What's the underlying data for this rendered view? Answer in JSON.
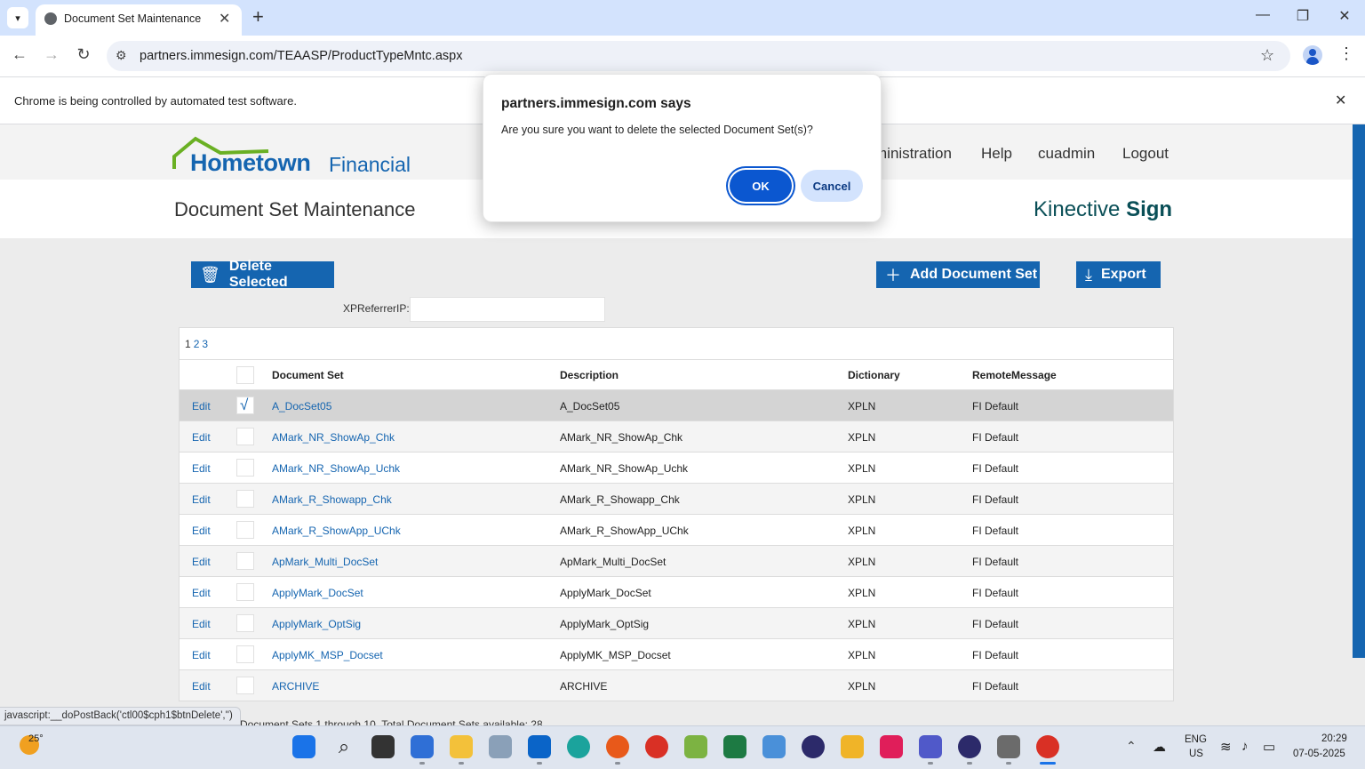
{
  "browser": {
    "tab_title": "Document Set Maintenance",
    "url": "partners.immesign.com/TEAASP/ProductTypeMntc.aspx",
    "infobar_text": "Chrome is being controlled by automated test software.",
    "status_url": "javascript:__doPostBack('ctl00$cph1$btnDelete','')"
  },
  "header": {
    "logo_main": "Hometown",
    "logo_sub": "Financial",
    "nav": [
      "ministration",
      "Help",
      "cuadmin",
      "Logout"
    ],
    "page_title": "Document Set Maintenance",
    "brand_regular": "Kinective ",
    "brand_bold": "Sign"
  },
  "actions": {
    "delete_selected": "Delete Selected",
    "add_document_set": "Add Document Set",
    "export": "Export"
  },
  "filter": {
    "label": "XPReferrerIP:",
    "value": ""
  },
  "grid": {
    "pages": [
      "1",
      "2",
      "3"
    ],
    "columns": [
      "Document Set",
      "Description",
      "Dictionary",
      "RemoteMessage"
    ],
    "edit_label": "Edit",
    "rows": [
      {
        "name": "A_DocSet05",
        "description": "A_DocSet05",
        "dictionary": "XPLN",
        "remote": "FI Default",
        "checked": true
      },
      {
        "name": "AMark_NR_ShowAp_Chk",
        "description": "AMark_NR_ShowAp_Chk",
        "dictionary": "XPLN",
        "remote": "FI Default",
        "checked": false
      },
      {
        "name": "AMark_NR_ShowAp_Uchk",
        "description": "AMark_NR_ShowAp_Uchk",
        "dictionary": "XPLN",
        "remote": "FI Default",
        "checked": false
      },
      {
        "name": "AMark_R_Showapp_Chk",
        "description": "AMark_R_Showapp_Chk",
        "dictionary": "XPLN",
        "remote": "FI Default",
        "checked": false
      },
      {
        "name": "AMark_R_ShowApp_UChk",
        "description": "AMark_R_ShowApp_UChk",
        "dictionary": "XPLN",
        "remote": "FI Default",
        "checked": false
      },
      {
        "name": "ApMark_Multi_DocSet",
        "description": "ApMark_Multi_DocSet",
        "dictionary": "XPLN",
        "remote": "FI Default",
        "checked": false
      },
      {
        "name": "ApplyMark_DocSet",
        "description": "ApplyMark_DocSet",
        "dictionary": "XPLN",
        "remote": "FI Default",
        "checked": false
      },
      {
        "name": "ApplyMark_OptSig",
        "description": "ApplyMark_OptSig",
        "dictionary": "XPLN",
        "remote": "FI Default",
        "checked": false
      },
      {
        "name": "ApplyMK_MSP_Docset",
        "description": "ApplyMK_MSP_Docset",
        "dictionary": "XPLN",
        "remote": "FI Default",
        "checked": false
      },
      {
        "name": "ARCHIVE",
        "description": "ARCHIVE",
        "dictionary": "XPLN",
        "remote": "FI Default",
        "checked": false
      }
    ],
    "summary": "Document Sets 1 through 10. Total Document Sets available: 28"
  },
  "dialog": {
    "title": "partners.immesign.com says",
    "message": "Are you sure you want to delete the selected Document Set(s)?",
    "ok": "OK",
    "cancel": "Cancel"
  },
  "taskbar": {
    "weather_temp": "25°",
    "lang_line1": "ENG",
    "lang_line2": "US",
    "time": "20:29",
    "date": "07-05-2025"
  },
  "colors": {
    "accent": "#1565b0",
    "dialog_ok": "#0b57d0",
    "dialog_cancel": "#d3e3fd"
  }
}
